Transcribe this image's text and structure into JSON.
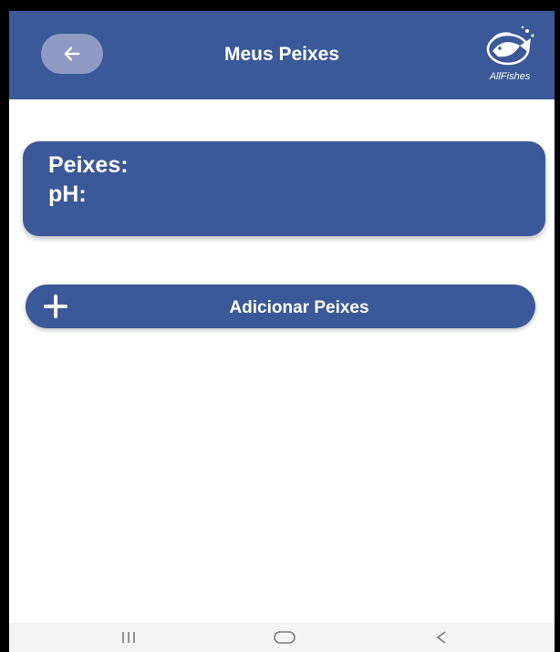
{
  "header": {
    "title": "Meus Peixes",
    "logo_text": "AllFishes"
  },
  "info_card": {
    "fishes_label": "Peixes:",
    "ph_label": "pH:"
  },
  "add_button": {
    "label": "Adicionar Peixes"
  },
  "icons": {
    "back": "arrow-left-icon",
    "logo": "fish-logo-icon",
    "add": "plus-icon",
    "nav_recent": "recent-apps-icon",
    "nav_home": "home-icon",
    "nav_back": "nav-back-icon"
  },
  "colors": {
    "primary": "#3b5998",
    "back_button": "#8f9bc3",
    "navbar": "#f4f4f4"
  }
}
